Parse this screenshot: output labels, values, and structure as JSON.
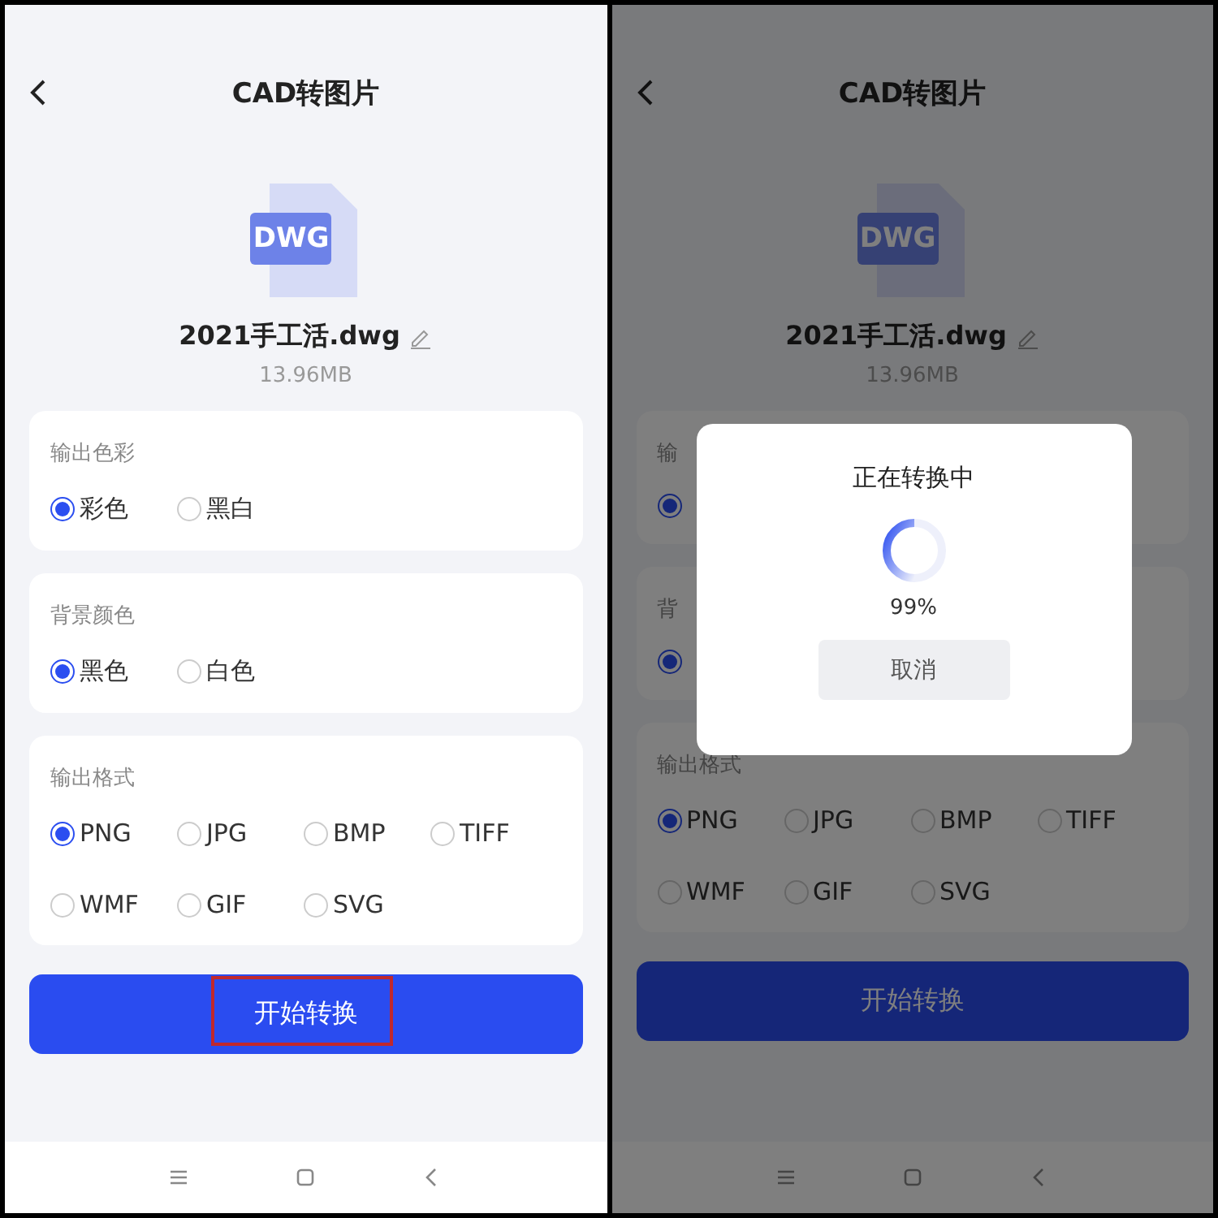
{
  "screens": [
    {
      "header": {
        "title": "CAD转图片"
      },
      "file": {
        "badge": "DWG",
        "name": "2021手工活.dwg",
        "size": "13.96MB"
      },
      "sections": [
        {
          "title": "输出色彩",
          "options": [
            {
              "label": "彩色",
              "selected": true
            },
            {
              "label": "黑白",
              "selected": false
            }
          ]
        },
        {
          "title": "背景颜色",
          "options": [
            {
              "label": "黑色",
              "selected": true
            },
            {
              "label": "白色",
              "selected": false
            }
          ]
        },
        {
          "title": "输出格式",
          "options": [
            {
              "label": "PNG",
              "selected": true
            },
            {
              "label": "JPG",
              "selected": false
            },
            {
              "label": "BMP",
              "selected": false
            },
            {
              "label": "TIFF",
              "selected": false
            },
            {
              "label": "WMF",
              "selected": false
            },
            {
              "label": "GIF",
              "selected": false
            },
            {
              "label": "SVG",
              "selected": false
            }
          ]
        }
      ],
      "start_button": {
        "label": "开始转换",
        "highlighted": true
      }
    },
    {
      "header": {
        "title": "CAD转图片"
      },
      "file": {
        "badge": "DWG",
        "name": "2021手工活.dwg",
        "size": "13.96MB"
      },
      "sections": [
        {
          "title": "输",
          "options": [
            {
              "selected": true
            }
          ]
        },
        {
          "title": "背",
          "options": [
            {
              "selected": true
            }
          ]
        },
        {
          "title": "输出格式",
          "options": [
            {
              "label": "PNG",
              "selected": true
            },
            {
              "label": "JPG",
              "selected": false
            },
            {
              "label": "BMP",
              "selected": false
            },
            {
              "label": "TIFF",
              "selected": false
            },
            {
              "label": "WMF",
              "selected": false
            },
            {
              "label": "GIF",
              "selected": false
            },
            {
              "label": "SVG",
              "selected": false
            }
          ]
        }
      ],
      "start_button": {
        "label": "开始转换",
        "highlighted": false
      },
      "dialog": {
        "title": "正在转换中",
        "percent": "99%",
        "cancel": "取消"
      }
    }
  ]
}
